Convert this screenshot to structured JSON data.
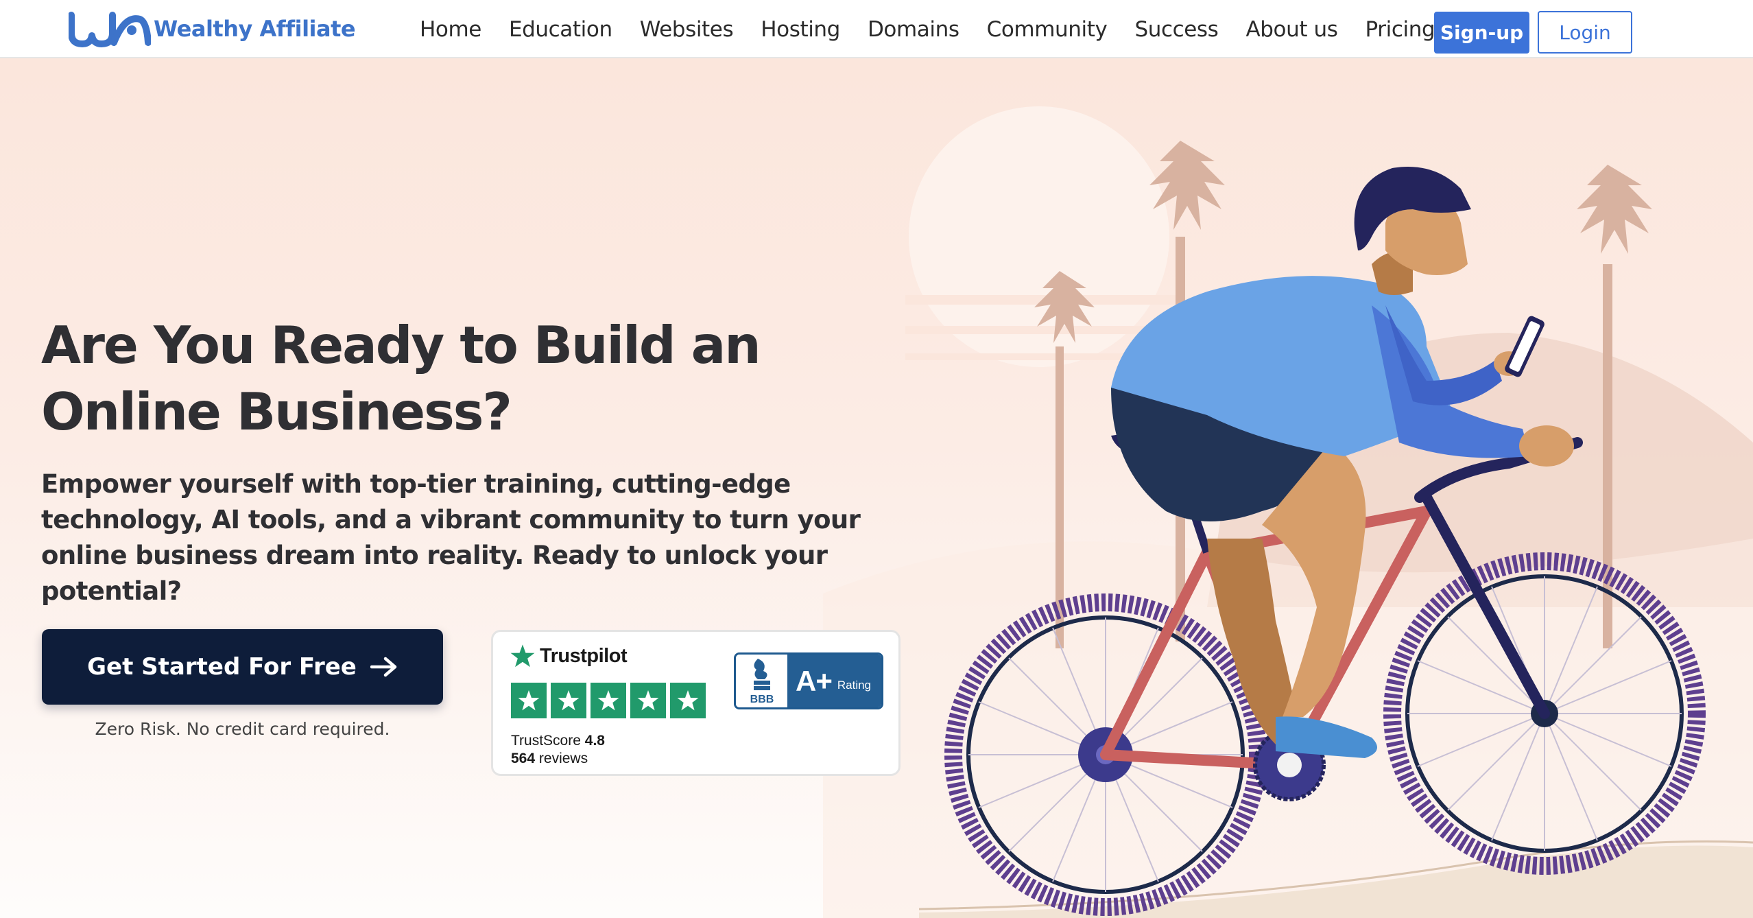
{
  "brand": {
    "name": "Wealthy Affiliate",
    "primary_color": "#3c73d9",
    "logo_color": "#3d73c9",
    "dark_color": "#0e1d3a"
  },
  "nav": {
    "items": [
      {
        "label": "Home"
      },
      {
        "label": "Education"
      },
      {
        "label": "Websites"
      },
      {
        "label": "Hosting"
      },
      {
        "label": "Domains"
      },
      {
        "label": "Community"
      },
      {
        "label": "Success"
      },
      {
        "label": "About us"
      },
      {
        "label": "Pricing"
      }
    ],
    "signup_label": "Sign-up",
    "login_label": "Login"
  },
  "hero": {
    "headline_line1": "Are You Ready to Build an",
    "headline_line2": "Online Business?",
    "subheadline": "Empower yourself with top-tier training, cutting-edge technology, AI tools, and a vibrant community to turn your online business dream into reality. Ready to unlock your potential?",
    "cta_label": "Get Started For Free",
    "cta_note": "Zero Risk. No credit card required.",
    "illustration": "cyclist-on-bike-with-phone-palm-trees-sunset"
  },
  "trust": {
    "trustpilot_name": "Trustpilot",
    "trustpilot_stars": 5,
    "trustscore_label": "TrustScore",
    "trustscore_value": "4.8",
    "reviews_count": "564",
    "reviews_label": "reviews",
    "bbb_label": "BBB",
    "bbb_grade": "A+",
    "bbb_rating_label": "Rating",
    "trustpilot_color": "#219a6b",
    "bbb_color": "#245e93"
  }
}
